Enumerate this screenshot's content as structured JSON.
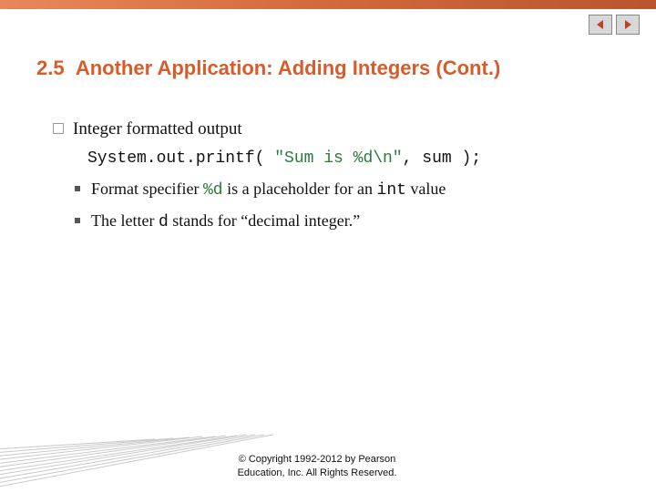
{
  "title": {
    "section": "2.5",
    "text": "Another Application: Adding Integers (Cont.)"
  },
  "bullet1": "Integer formatted output",
  "code": {
    "pre": "System.out.printf( ",
    "str": "\"Sum is %d\\n\"",
    "post": ", sum );"
  },
  "sub1": {
    "pre": "Format specifier ",
    "spec": "%d",
    "mid": " is a placeholder for an ",
    "type": "int",
    "post": " value"
  },
  "sub2": {
    "pre": "The letter ",
    "letter": "d",
    "post": " stands for “decimal integer.”"
  },
  "copyright_line1": "© Copyright 1992-2012 by Pearson",
  "copyright_line2": "Education, Inc. All Rights Reserved.",
  "nav": {
    "prev": "previous",
    "next": "next"
  }
}
